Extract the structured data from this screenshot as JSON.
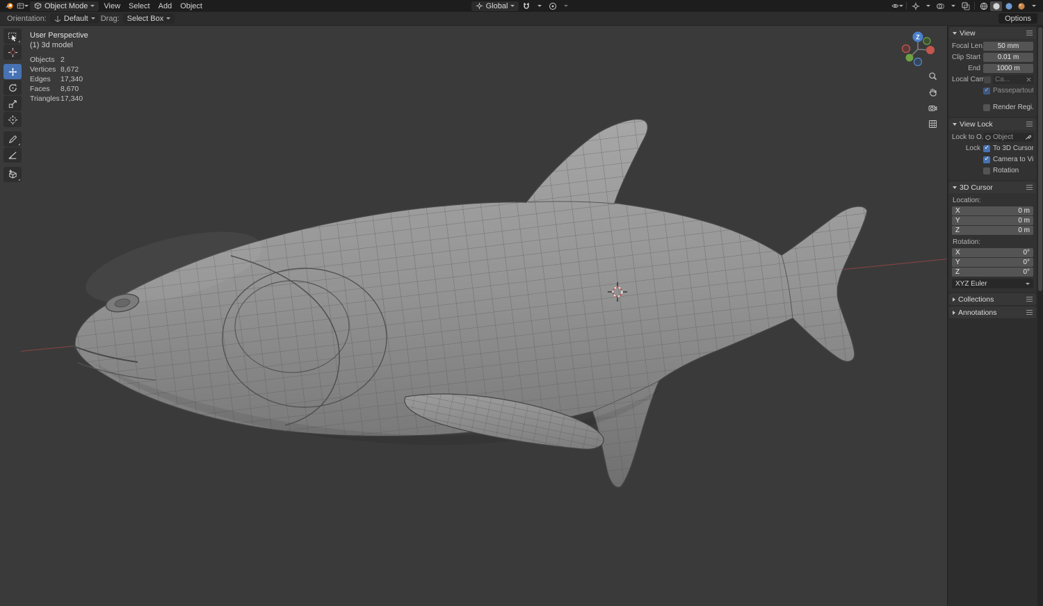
{
  "header": {
    "mode_select": "Object Mode",
    "menus": [
      "View",
      "Select",
      "Add",
      "Object"
    ],
    "orientation_select": "Global",
    "left_icons": [
      "blender-logo",
      "editor-type"
    ],
    "center_icons": [
      "transform-orientation",
      "snap-magnet",
      "snap-dropdown",
      "proportional-editing",
      "proportional-falloff-dropdown"
    ],
    "right_icons": [
      "object-visibility",
      "gizmos",
      "overlays",
      "toggle-xray",
      "shading-wireframe",
      "shading-solid",
      "shading-material",
      "shading-rendered"
    ]
  },
  "tool_settings": {
    "orientation_label": "Orientation:",
    "orientation_value": "Default",
    "drag_label": "Drag:",
    "drag_value": "Select Box",
    "options_button": "Options"
  },
  "toolshelf": {
    "tools": [
      "select-box",
      "cursor",
      "move",
      "rotate",
      "scale",
      "transform",
      "annotate",
      "measure",
      "add-cube"
    ],
    "active_tool": "move"
  },
  "viewport": {
    "overlay": {
      "view_name": "User Perspective",
      "scene_name": "(1) 3d model",
      "stats": [
        {
          "label": "Objects",
          "value": "2"
        },
        {
          "label": "Vertices",
          "value": "8,672"
        },
        {
          "label": "Edges",
          "value": "17,340"
        },
        {
          "label": "Faces",
          "value": "8,670"
        },
        {
          "label": "Triangles",
          "value": "17,340"
        }
      ]
    },
    "gizmo": {
      "axis_label": "Z"
    },
    "controls": [
      "zoom",
      "pan",
      "camera-view",
      "toggle-orthographic"
    ]
  },
  "sidebar": {
    "view_panel": {
      "title": "View",
      "rows": [
        {
          "label": "Focal Len...",
          "value": "50 mm"
        },
        {
          "label": "Clip Start",
          "value": "0.01 m"
        },
        {
          "label": "End",
          "value": "1000 m"
        }
      ],
      "local_camera_label": "Local Cam...",
      "local_camera_value": "Ca...",
      "passepartout": {
        "label": "Passepartout",
        "checked": true
      },
      "render_region": {
        "label": "Render Regi...",
        "checked": false
      }
    },
    "view_lock_panel": {
      "title": "View Lock",
      "lock_to_label": "Lock to O...",
      "lock_to_value": "Object",
      "lock_label": "Lock",
      "checkboxes": [
        {
          "label": "To 3D Cursor",
          "checked": true
        },
        {
          "label": "Camera to Vi...",
          "checked": true
        },
        {
          "label": "Rotation",
          "checked": false
        }
      ]
    },
    "cursor_panel": {
      "title": "3D Cursor",
      "location_label": "Location:",
      "location": [
        {
          "axis": "X",
          "value": "0 m"
        },
        {
          "axis": "Y",
          "value": "0 m"
        },
        {
          "axis": "Z",
          "value": "0 m"
        }
      ],
      "rotation_label": "Rotation:",
      "rotation": [
        {
          "axis": "X",
          "value": "0°"
        },
        {
          "axis": "Y",
          "value": "0°"
        },
        {
          "axis": "Z",
          "value": "0°"
        }
      ],
      "euler_select": "XYZ Euler"
    },
    "collections_panel": {
      "title": "Collections"
    },
    "annotations_panel": {
      "title": "Annotations"
    }
  },
  "colors": {
    "accent": "#4772b3",
    "header_bg": "#1d1d1d",
    "viewport_bg": "#3a3a3a",
    "field_bg": "#545454",
    "axis_x": "#9a4747"
  }
}
